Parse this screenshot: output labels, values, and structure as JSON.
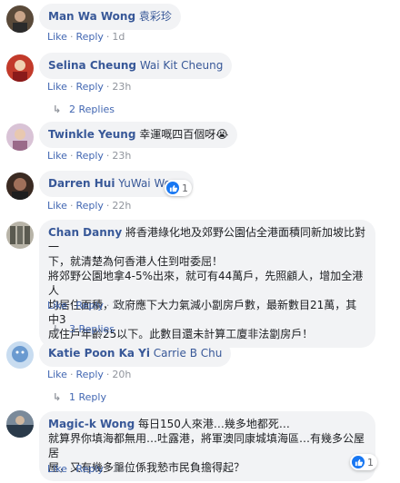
{
  "actions": {
    "like": "Like",
    "reply": "Reply"
  },
  "comments": [
    {
      "author": "Man Wa Wong",
      "tag": "袁彩珍",
      "time": "1d"
    },
    {
      "author": "Selina Cheung",
      "tag": "Wai Kit Cheung",
      "time": "23h",
      "replies": "2 Replies"
    },
    {
      "author": "Twinkle Yeung",
      "text": "幸運嘅四百個呀😭",
      "time": "23h"
    },
    {
      "author": "Darren Hui",
      "tag": "YuWai Wong",
      "time": "22h",
      "reactions": "1"
    },
    {
      "author": "Chan Danny",
      "line1": "將香港綠化地及郊野公園佔全港面積同新加坡比對一",
      "line2": "下，就清楚為何香港人住到咁委屈！",
      "line3": "將郊野公園地拿4-5%出來，就可有44萬戶，先照顧人，增加全港人",
      "line4": "均居住面積，政府應下大力氣減小劏房戶數，最新數目21萬，其中3",
      "line5": "成住戶年齡25以下。此數目還未計算工廈非法劏房戶！",
      "time": "21h",
      "replies": "3 Replies"
    },
    {
      "author": "Katie Poon Ka Yi",
      "tag": "Carrie B Chu",
      "time": "20h",
      "replies": "1 Reply"
    },
    {
      "author": "Magic-k Wong",
      "line1": "每日150人來港…幾多地都死…",
      "line2": "就算界你填海都無用…吐露港，將軍澳同康城填海區…有幾多公屋居",
      "line3": "屋，又有幾多單位係我慹市民負擔得起？",
      "time": "18h",
      "reactions": "1"
    }
  ]
}
